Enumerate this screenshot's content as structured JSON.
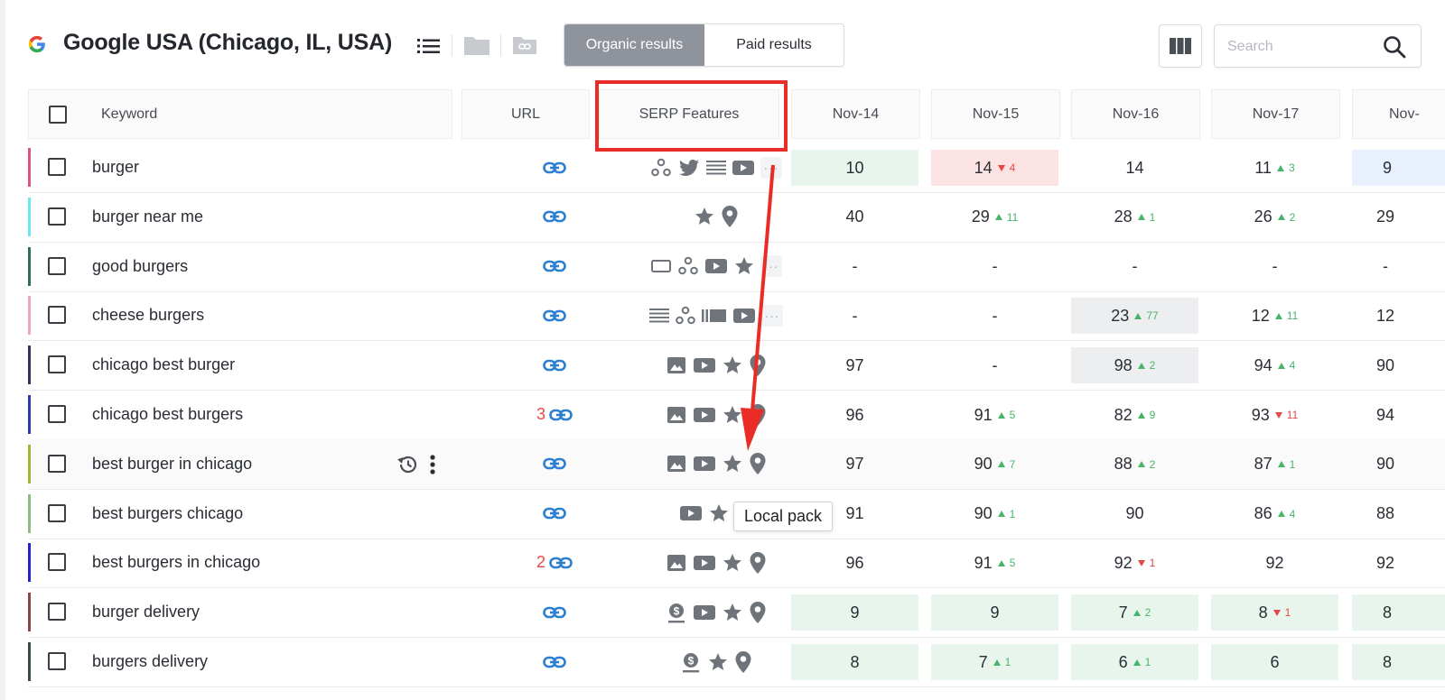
{
  "header": {
    "title": "Google USA (Chicago, IL, USA)",
    "tabs": [
      {
        "label": "Organic results",
        "active": true
      },
      {
        "label": "Paid results",
        "active": false
      }
    ],
    "search_placeholder": "Search"
  },
  "columns": {
    "keyword": "Keyword",
    "url": "URL",
    "serp": "SERP Features",
    "dates": [
      "Nov-14",
      "Nov-15",
      "Nov-16",
      "Nov-17",
      "Nov-"
    ]
  },
  "tooltip": "Local pack",
  "colors": {
    "accent_red": "#ea2c26",
    "up": "#47b46a",
    "down": "#e74646",
    "link": "#2d7fd0"
  },
  "rows": [
    {
      "keyword": "burger",
      "color": "#d9577b",
      "url_count": "",
      "features": [
        "network-icon",
        "twitter-icon",
        "list-icon",
        "video-icon",
        "more-icon"
      ],
      "cells": [
        {
          "v": "10",
          "bg": "green"
        },
        {
          "v": "14",
          "bg": "red",
          "chg": "4",
          "dir": "down"
        },
        {
          "v": "14"
        },
        {
          "v": "11",
          "chg": "3",
          "dir": "up"
        },
        {
          "v": "9",
          "bg": "blue"
        }
      ]
    },
    {
      "keyword": "burger near me",
      "color": "#6ee6ed",
      "url_count": "",
      "features": [
        "star-icon",
        "pin-icon"
      ],
      "cells": [
        {
          "v": "40"
        },
        {
          "v": "29",
          "chg": "11",
          "dir": "up"
        },
        {
          "v": "28",
          "chg": "1",
          "dir": "up"
        },
        {
          "v": "26",
          "chg": "2",
          "dir": "up"
        },
        {
          "v": "29"
        }
      ]
    },
    {
      "keyword": "good burgers",
      "color": "#2f6e63",
      "url_count": "",
      "features": [
        "rectangle-icon",
        "network-icon",
        "video-icon",
        "star-icon",
        "more-icon"
      ],
      "cells": [
        {
          "v": "-"
        },
        {
          "v": "-"
        },
        {
          "v": "-"
        },
        {
          "v": "-"
        },
        {
          "v": "-"
        }
      ]
    },
    {
      "keyword": "cheese burgers",
      "color": "#f2a3bd",
      "url_count": "",
      "features": [
        "list-icon",
        "network-icon",
        "carousel-icon",
        "video-icon",
        "more-icon"
      ],
      "cells": [
        {
          "v": "-"
        },
        {
          "v": "-"
        },
        {
          "v": "23",
          "bg": "gray",
          "chg": "77",
          "dir": "up"
        },
        {
          "v": "12",
          "chg": "11",
          "dir": "up"
        },
        {
          "v": "12"
        }
      ]
    },
    {
      "keyword": "chicago best burger",
      "color": "#3a2f5e",
      "url_count": "",
      "features": [
        "image-icon",
        "video-icon",
        "star-icon",
        "pin-icon"
      ],
      "cells": [
        {
          "v": "97"
        },
        {
          "v": "-"
        },
        {
          "v": "98",
          "bg": "gray",
          "chg": "2",
          "dir": "up"
        },
        {
          "v": "94",
          "chg": "4",
          "dir": "up"
        },
        {
          "v": "90"
        }
      ]
    },
    {
      "keyword": "chicago best burgers",
      "color": "#2b3aa8",
      "url_count": "3",
      "features": [
        "image-icon",
        "video-icon",
        "star-icon",
        "pin-icon"
      ],
      "cells": [
        {
          "v": "96"
        },
        {
          "v": "91",
          "chg": "5",
          "dir": "up"
        },
        {
          "v": "82",
          "chg": "9",
          "dir": "up"
        },
        {
          "v": "93",
          "chg": "11",
          "dir": "down"
        },
        {
          "v": "94"
        }
      ]
    },
    {
      "keyword": "best burger in chicago",
      "color": "#a2b539",
      "url_count": "",
      "highlight": true,
      "features": [
        "image-icon",
        "video-icon",
        "star-icon",
        "pin-icon"
      ],
      "cells": [
        {
          "v": "97"
        },
        {
          "v": "90",
          "chg": "7",
          "dir": "up"
        },
        {
          "v": "88",
          "chg": "2",
          "dir": "up"
        },
        {
          "v": "87",
          "chg": "1",
          "dir": "up"
        },
        {
          "v": "90"
        }
      ]
    },
    {
      "keyword": "best burgers chicago",
      "color": "#8fba86",
      "url_count": "",
      "features": [
        "video-icon",
        "star-icon",
        "pin-icon"
      ],
      "cells": [
        {
          "v": "91"
        },
        {
          "v": "90",
          "chg": "1",
          "dir": "up"
        },
        {
          "v": "90"
        },
        {
          "v": "86",
          "chg": "4",
          "dir": "up"
        },
        {
          "v": "88"
        }
      ]
    },
    {
      "keyword": "best burgers in chicago",
      "color": "#2323c9",
      "url_count": "2",
      "features": [
        "image-icon",
        "video-icon",
        "star-icon",
        "pin-icon"
      ],
      "cells": [
        {
          "v": "96"
        },
        {
          "v": "91",
          "chg": "5",
          "dir": "up"
        },
        {
          "v": "92",
          "chg": "1",
          "dir": "down"
        },
        {
          "v": "92"
        },
        {
          "v": "92"
        }
      ]
    },
    {
      "keyword": "burger delivery",
      "color": "#8a4545",
      "url_count": "",
      "features": [
        "money-icon",
        "video-icon",
        "star-icon",
        "pin-icon"
      ],
      "cells": [
        {
          "v": "9",
          "bg": "green"
        },
        {
          "v": "9",
          "bg": "green"
        },
        {
          "v": "7",
          "bg": "green",
          "chg": "2",
          "dir": "up"
        },
        {
          "v": "8",
          "bg": "green",
          "chg": "1",
          "dir": "down"
        },
        {
          "v": "8",
          "bg": "green"
        }
      ]
    },
    {
      "keyword": "burgers delivery",
      "color": "#3a4a45",
      "url_count": "",
      "features": [
        "money-icon",
        "star-icon",
        "pin-icon"
      ],
      "cells": [
        {
          "v": "8",
          "bg": "green"
        },
        {
          "v": "7",
          "bg": "green",
          "chg": "1",
          "dir": "up"
        },
        {
          "v": "6",
          "bg": "green",
          "chg": "1",
          "dir": "up"
        },
        {
          "v": "6",
          "bg": "green"
        },
        {
          "v": "8",
          "bg": "green"
        }
      ]
    }
  ]
}
